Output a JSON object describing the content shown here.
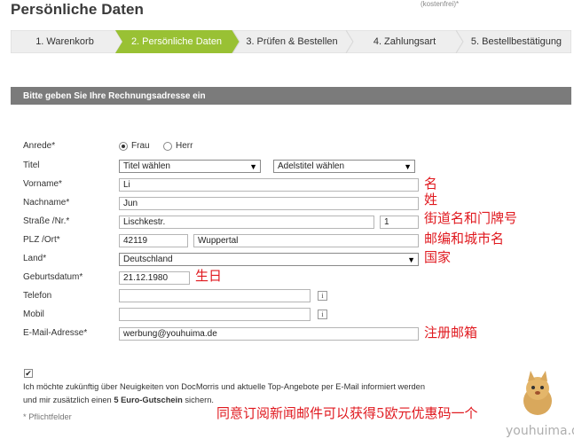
{
  "page": {
    "title": "Persönliche Daten",
    "top_note": "(kostenfrei)*"
  },
  "steps": [
    {
      "label": "1. Warenkorb",
      "active": false
    },
    {
      "label": "2. Persönliche Daten",
      "active": true
    },
    {
      "label": "3. Prüfen & Bestellen",
      "active": false
    },
    {
      "label": "4. Zahlungsart",
      "active": false
    },
    {
      "label": "5. Bestellbestätigung",
      "active": false
    }
  ],
  "colors": {
    "active_step": "#99c134",
    "step_bg": "#eeeeee",
    "section_header": "#7b7b7b",
    "annotation": "#e0191f"
  },
  "section": {
    "title": "Bitte geben Sie Ihre Rechnungsadresse ein"
  },
  "form": {
    "anrede": {
      "label": "Anrede*",
      "options": [
        "Frau",
        "Herr"
      ],
      "selected": "Frau"
    },
    "titel": {
      "label": "Titel",
      "select1": "Titel wählen",
      "select2": "Adelstitel wählen"
    },
    "vorname": {
      "label": "Vorname*",
      "value": "Li"
    },
    "nachname": {
      "label": "Nachname*",
      "value": "Jun"
    },
    "strasse": {
      "label": "Straße /Nr.*",
      "value": "Lischkestr.",
      "nr": "1"
    },
    "plz_ort": {
      "label": "PLZ /Ort*",
      "plz": "42119",
      "ort": "Wuppertal"
    },
    "land": {
      "label": "Land*",
      "value": "Deutschland"
    },
    "geburtsdatum": {
      "label": "Geburtsdatum*",
      "value": "21.12.1980"
    },
    "telefon": {
      "label": "Telefon",
      "value": ""
    },
    "mobil": {
      "label": "Mobil",
      "value": ""
    },
    "email": {
      "label": "E-Mail-Adresse*",
      "value": "werbung@youhuima.de"
    }
  },
  "newsletter": {
    "checked": true,
    "line1": "Ich möchte zukünftig über Neuigkeiten von DocMorris und aktuelle Top-Angebote per E-Mail informiert werden",
    "line2_pre": "und mir zusätzlich einen ",
    "line2_bold": "5 Euro-Gutschein",
    "line2_post": " sichern."
  },
  "required_note": "* Pflichtfelder",
  "annotations": {
    "vorname": "名",
    "nachname": "姓",
    "strasse": "街道名和门牌号",
    "plz_ort": "邮编和城市名",
    "land": "国家",
    "geburtsdatum": "生日",
    "email": "注册邮箱",
    "newsletter": "同意订阅新闻邮件可以获得5欧元优惠码一个"
  },
  "icons": {
    "info": "info-icon",
    "check": "✔",
    "dropdown": "▼",
    "mascot": "mascot-icon"
  },
  "info_glyph": "i",
  "watermark": "youhuima.de"
}
